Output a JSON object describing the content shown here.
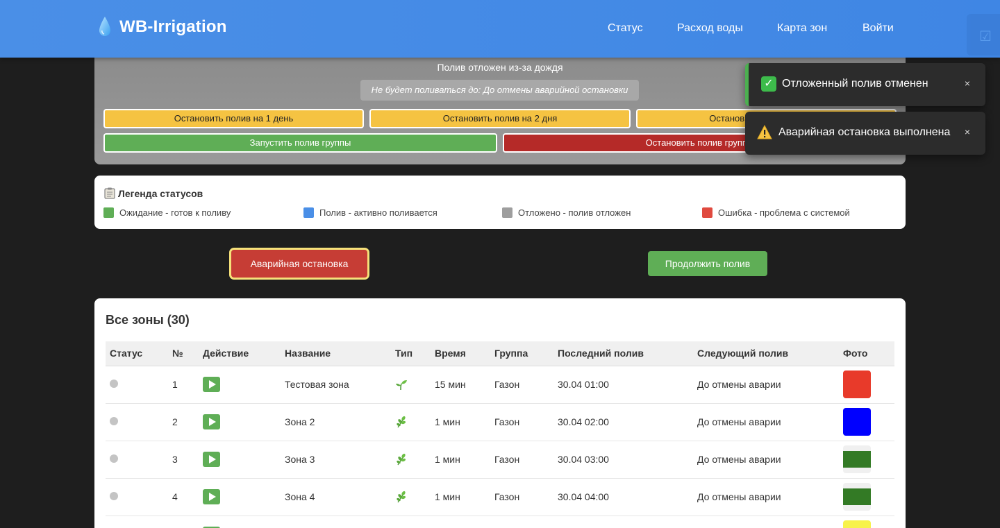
{
  "header": {
    "brand": "WB-Irrigation",
    "nav": [
      "Статус",
      "Расход воды",
      "Карта зон",
      "Войти"
    ],
    "corner_icon": "check-square-icon"
  },
  "postpone": {
    "title": "Полив отложен из-за дождя",
    "until": "Не будет поливаться до: До отмены аварийной остановки",
    "buttons": {
      "stop_1_day": "Остановить полив на 1 день",
      "stop_2_days": "Остановить полив на 2 дня",
      "stop_3_days": "Остановить полив на 3 дня",
      "start_group": "Запустить полив группы",
      "stop_group": "Остановить полив группы"
    }
  },
  "toasts": [
    {
      "icon": "check-mark-icon",
      "text": "Отложенный полив отменен",
      "close": "×",
      "color": "#4caf50"
    },
    {
      "icon": "warning-icon",
      "text": "Аварийная остановка выполнена",
      "close": "×",
      "color": "#f5c342"
    }
  ],
  "legend": {
    "title": "Легенда статусов",
    "icon": "clipboard-icon",
    "items": [
      {
        "label": "Ожидание - готов к поливу",
        "color": "#5fae56"
      },
      {
        "label": "Полив - активно поливается",
        "color": "#4a8fe7"
      },
      {
        "label": "Отложено - полив отложен",
        "color": "#9e9e9e"
      },
      {
        "label": "Ошибка - проблема с системой",
        "color": "#e04a3f"
      }
    ]
  },
  "controls": {
    "emergency": "Аварийная остановка",
    "resume": "Продолжить полив"
  },
  "zones": {
    "title": "Все зоны (30)",
    "columns": [
      "Статус",
      "№",
      "Действие",
      "Название",
      "Тип",
      "Время",
      "Группа",
      "Последний полив",
      "Следующий полив",
      "Фото"
    ],
    "rows": [
      {
        "num": "1",
        "name": "Тестовая зона",
        "type": "seedling-icon",
        "time": "15 мин",
        "group": "Газон",
        "last": "30.04 01:00",
        "next": "До отмены аварии",
        "photo": "#e83a2a"
      },
      {
        "num": "2",
        "name": "Зона 2",
        "type": "herb-icon",
        "time": "1 мин",
        "group": "Газон",
        "last": "30.04 02:00",
        "next": "До отмены аварии",
        "photo": "#0000ff"
      },
      {
        "num": "3",
        "name": "Зона 3",
        "type": "herb-icon",
        "time": "1 мин",
        "group": "Газон",
        "last": "30.04 03:00",
        "next": "До отмены аварии",
        "photo": "#337a25"
      },
      {
        "num": "4",
        "name": "Зона 4",
        "type": "herb-icon",
        "time": "1 мин",
        "group": "Газон",
        "last": "30.04 04:00",
        "next": "До отмены аварии",
        "photo": "#337a25"
      },
      {
        "num": "",
        "name": "",
        "type": "",
        "time": "",
        "group": "",
        "last": "",
        "next": "",
        "photo": "#f7f24a"
      }
    ]
  }
}
